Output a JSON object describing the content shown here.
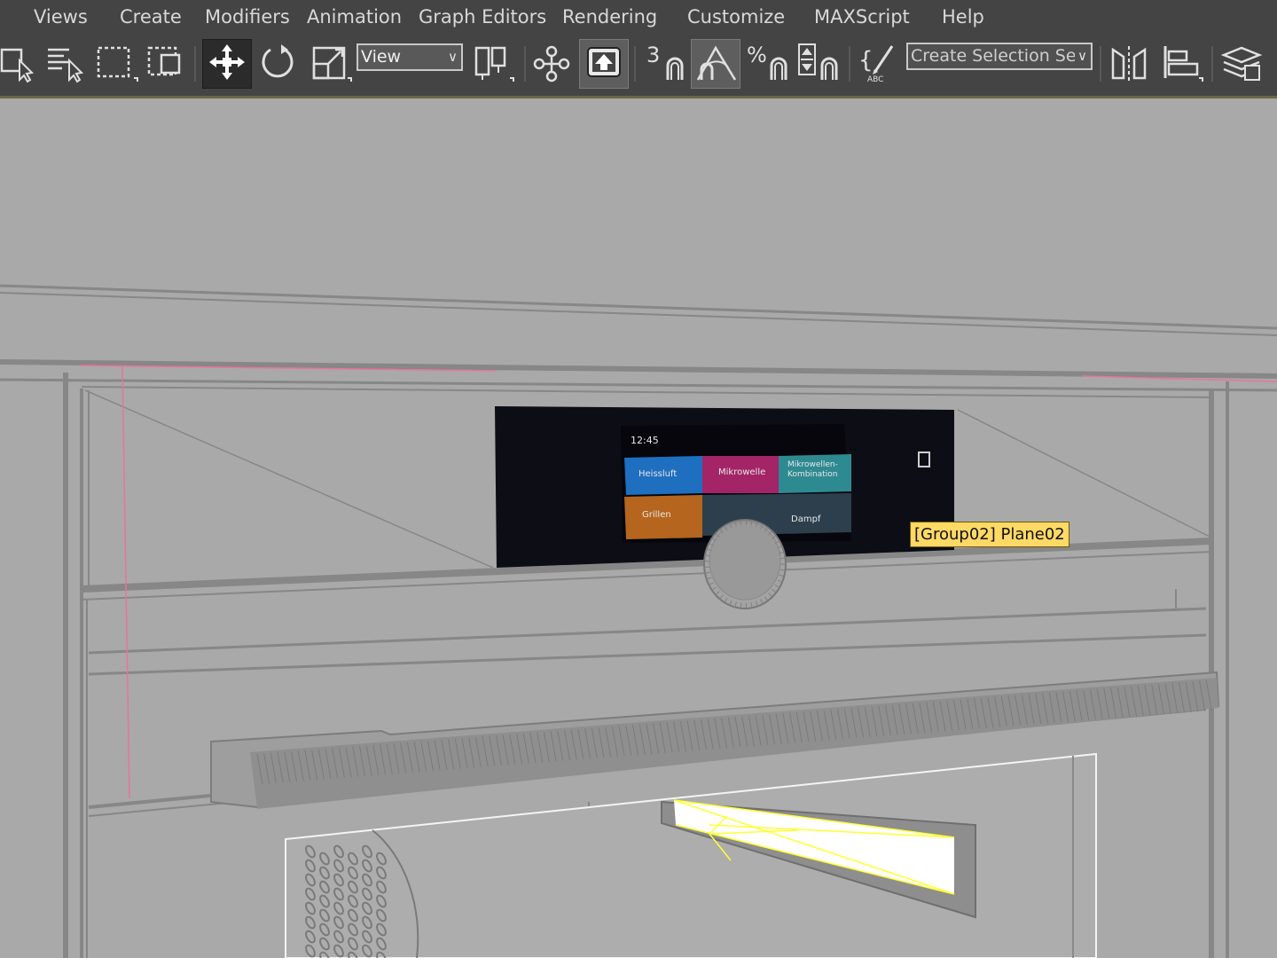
{
  "menu": {
    "items": [
      "Views",
      "Create",
      "Modifiers",
      "Animation",
      "Graph Editors",
      "Rendering",
      "Customize",
      "MAXScript",
      "Help"
    ]
  },
  "toolbar": {
    "reference_coord": "View",
    "selection_set_placeholder": "Create Selection Se",
    "snap_toggle_label": "3",
    "icons": [
      "select-object-icon",
      "select-by-name-icon",
      "rectangular-selection-icon",
      "window-crossing-icon",
      "select-and-move-icon",
      "select-and-rotate-icon",
      "select-and-scale-icon",
      "use-pivot-point-icon",
      "manipulate-icon",
      "keyboard-shortcut-override-icon",
      "snaps-toggle-icon",
      "angle-snap-icon",
      "percent-snap-icon",
      "spinner-snap-icon",
      "edit-named-selection-icon",
      "mirror-icon",
      "align-icon",
      "layer-explorer-icon"
    ]
  },
  "viewport": {
    "tooltip": "[Group02] Plane02",
    "oven_display": {
      "time": "12:45",
      "tiles": [
        "Heissluft",
        "Mikrowelle",
        "Mikrowellen-Kombination",
        "Grillen",
        "Dampf"
      ]
    }
  },
  "colors": {
    "ui_background": "#444444",
    "viewport_background": "#a9a9a9",
    "tooltip_background": "#ffd966",
    "wire_selected": "#ffff00",
    "tile_blue": "#1e6fc0",
    "tile_magenta": "#a32467",
    "tile_teal": "#2e8a91",
    "tile_orange": "#b5651d"
  }
}
